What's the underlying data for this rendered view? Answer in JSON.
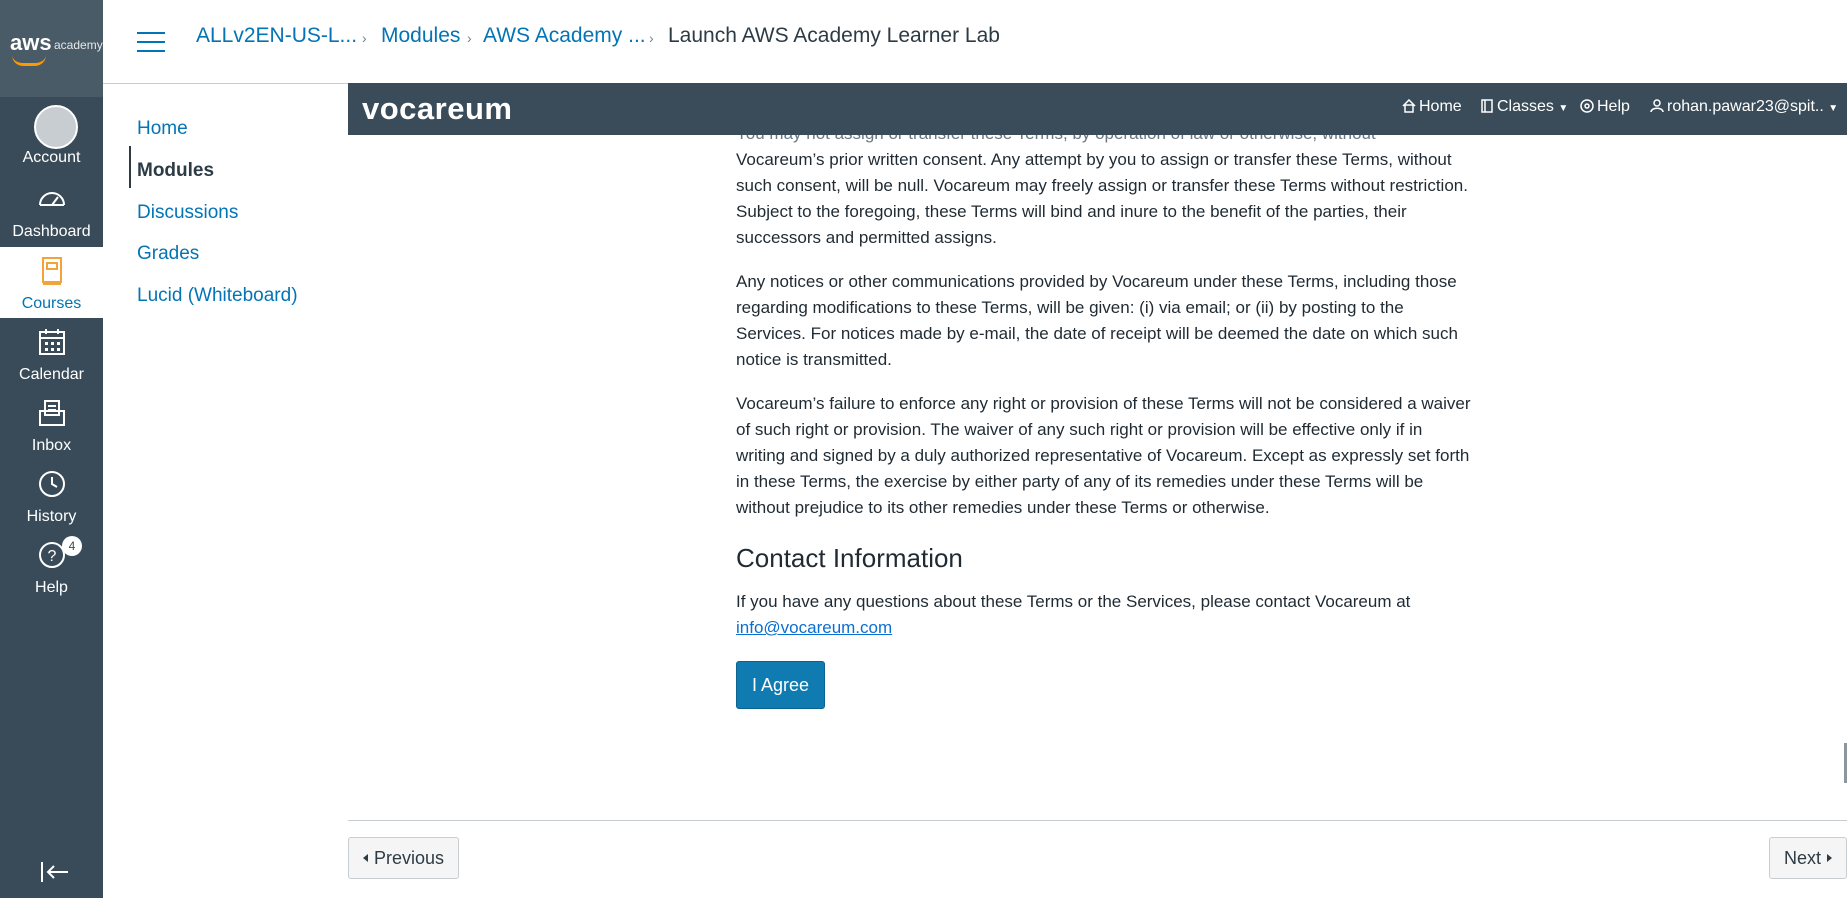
{
  "brand": {
    "aws": "aws",
    "academy": "academy"
  },
  "global_nav": {
    "account": "Account",
    "dashboard": "Dashboard",
    "courses": "Courses",
    "calendar": "Calendar",
    "inbox": "Inbox",
    "history": "History",
    "help": "Help",
    "help_badge": "4"
  },
  "breadcrumbs": {
    "course": "ALLv2EN-US-L...",
    "modules": "Modules",
    "module": "AWS Academy ...",
    "current": "Launch AWS Academy Learner Lab"
  },
  "course_nav": {
    "home": "Home",
    "modules": "Modules",
    "discussions": "Discussions",
    "grades": "Grades",
    "lucid": "Lucid (Whiteboard)"
  },
  "vocareum": {
    "logo": "vocareum",
    "home": "Home",
    "classes": "Classes",
    "help": "Help",
    "user": "rohan.pawar23@spit.."
  },
  "terms": {
    "p0_partial": "You may not assign or transfer these Terms, by operation of law or otherwise, without",
    "p1": "Vocareum’s prior written consent. Any attempt by you to assign or transfer these Terms, without such consent, will be null. Vocareum may freely assign or transfer these Terms without restriction. Subject to the foregoing, these Terms will bind and inure to the benefit of the parties, their successors and permitted assigns.",
    "p2": "Any notices or other communications provided by Vocareum under these Terms, including those regarding modifications to these Terms, will be given: (i) via email; or (ii) by posting to the Services. For notices made by e-mail, the date of receipt will be deemed the date on which such notice is transmitted.",
    "p3": "Vocareum’s failure to enforce any right or provision of these Terms will not be considered a waiver of such right or provision. The waiver of any such right or provision will be effective only if in writing and signed by a duly authorized representative of Vocareum. Except as expressly set forth in these Terms, the exercise by either party of any of its remedies under these Terms will be without prejudice to its other remedies under these Terms or otherwise.",
    "contact_heading": "Contact Information",
    "contact_text": "If you have any questions about these Terms or the Services, please contact Vocareum at",
    "contact_email": "info@vocareum.com",
    "agree_button": "I Agree"
  },
  "footer": {
    "previous": "Previous",
    "next": "Next"
  },
  "colors": {
    "nav_bg": "#394b58",
    "link": "#0374b5",
    "voc_bar": "#3a4c59",
    "agree": "#0f7bb0"
  }
}
